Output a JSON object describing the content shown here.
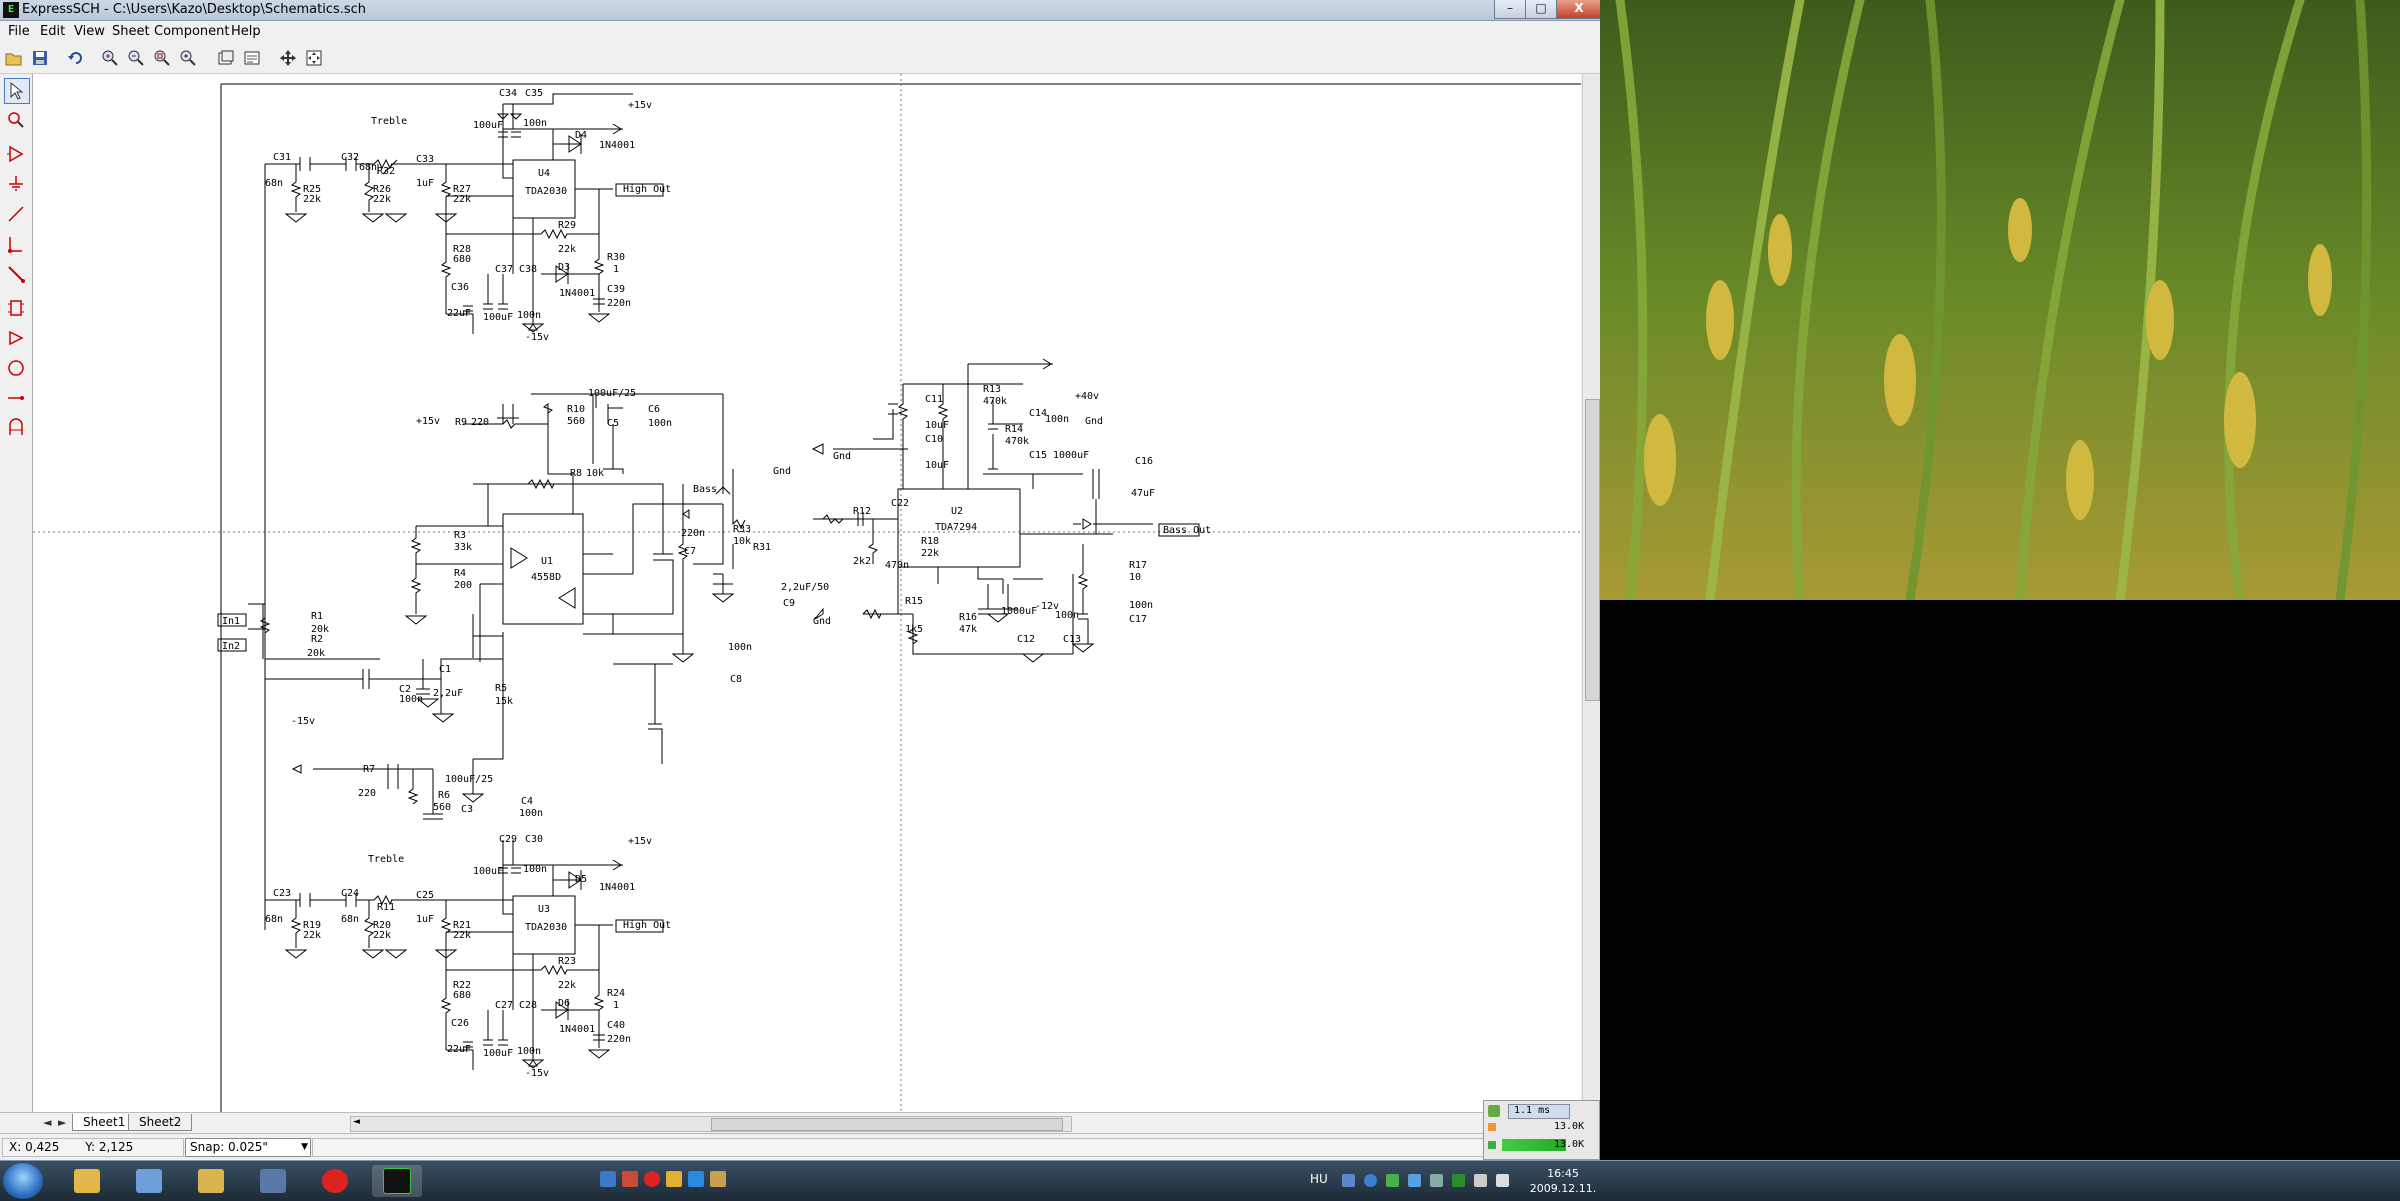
{
  "window": {
    "title": "ExpressSCH - C:\\Users\\Kazo\\Desktop\\Schematics.sch",
    "icon": "expresssch-icon",
    "minimize": "–",
    "maximize": "□",
    "close": "X"
  },
  "menu": [
    "File",
    "Edit",
    "View",
    "Sheet",
    "Component",
    "Help"
  ],
  "toolbar": [
    "open-icon",
    "save-icon",
    "undo-icon",
    "zoom-in-icon",
    "zoom-out-icon",
    "zoom-area-icon",
    "zoom-fit-icon",
    "sheet-icon",
    "sheet-props-icon",
    "move-icon",
    "pan-icon"
  ],
  "tools": [
    "select-pointer-icon",
    "zoom-select-icon",
    "component-icon",
    "ground-icon",
    "wire-icon",
    "junction-icon",
    "bus-icon",
    "part-icon",
    "port-icon",
    "circle-icon",
    "line-arrow-icon",
    "text-icon"
  ],
  "sheets": {
    "tabs": [
      "Sheet1",
      "Sheet2"
    ],
    "nav_left": "◄",
    "nav_right": "►",
    "hscroll_left": "◄",
    "hscroll_right": "►"
  },
  "status": {
    "x": "X: 0,425",
    "y": "Y: 2,125",
    "snap": "Snap: 0.025\""
  },
  "schematic": {
    "rails": {
      "plus15": "+15v",
      "minus15": "-15v",
      "plus40": "+40v",
      "minus12": "-12v",
      "gnd": "Gnd"
    },
    "ports": {
      "in1": "In1",
      "in2": "In2",
      "high_out": "High Out",
      "bass_out": "Bass Out"
    },
    "labels": {
      "treble": "Treble",
      "bass": "Bass"
    },
    "ics": {
      "u4_ref": "U4",
      "u4_part": "TDA2030",
      "u3_ref": "U3",
      "u3_part": "TDA2030",
      "u1_ref": "U1",
      "u1_part": "4558D",
      "u2_ref": "U2",
      "u2_part": "TDA7294"
    },
    "parts": {
      "c34": "C34",
      "c35": "C35",
      "c34v": "100uF",
      "c35v": "100n",
      "d4": "D4",
      "d4v": "1N4001",
      "c31": "C31",
      "c31v": "68n",
      "c32": "C32",
      "c32v": "68n",
      "c33": "C33",
      "c33v": "1uF",
      "r32": "R32",
      "r25": "R25",
      "r25v": "22k",
      "r26": "R26",
      "r26v": "22k",
      "r27": "R27",
      "r27v": "22k",
      "r28": "R28",
      "r28v": "680",
      "r29": "R29",
      "r29v": "22k",
      "d3": "D3",
      "d3v": "1N4001",
      "c36": "C36",
      "c36v": "22uF",
      "c37": "C37",
      "c37v": "100uF",
      "c38": "C38",
      "c38v": "100n",
      "r30": "R30",
      "r30v": "1",
      "c39": "C39",
      "c39v": "220n",
      "c29": "C29",
      "c30": "C30",
      "c29v": "100uF",
      "c30v": "100n",
      "d5": "D5",
      "d5v": "1N4001",
      "c23": "C23",
      "c23v": "68n",
      "c24": "C24",
      "c24v": "68n",
      "c25": "C25",
      "c25v": "1uF",
      "r11": "R11",
      "r19": "R19",
      "r19v": "22k",
      "r20": "R20",
      "r20v": "22k",
      "r21": "R21",
      "r21v": "22k",
      "r22": "R22",
      "r22v": "680",
      "r23": "R23",
      "r23v": "22k",
      "d6": "D6",
      "d6v": "1N4001",
      "c26": "C26",
      "c26v": "22uF",
      "c27": "C27",
      "c27v": "100uF",
      "c28": "C28",
      "c28v": "100n",
      "r24": "R24",
      "r24v": "1",
      "c40": "C40",
      "c40v": "220n",
      "r9": "R9",
      "r9v": "220",
      "r10": "R10",
      "r10v": "560",
      "c5": "C5",
      "c5v": "100uF/25",
      "c6": "C6",
      "c6v": "100n",
      "r8": "R8",
      "r8v": "10k",
      "r3": "R3",
      "r3v": "33k",
      "r4": "R4",
      "r4v": "200",
      "c7": "C7",
      "c7v": "220n",
      "r33": "R33",
      "r33v": "10k",
      "c8": "C8",
      "c8v": "100n",
      "r1": "R1",
      "r1v": "20k",
      "r2": "R2",
      "r2v": "20k",
      "c1": "C1",
      "c1v": "2,2uF",
      "c2": "C2",
      "c2v": "100n",
      "r5": "R5",
      "r5v": "15k",
      "r7": "R7",
      "r7v": "220",
      "r6": "R6",
      "r6v": "560",
      "c3": "C3",
      "c3v": "100uF/25",
      "c4": "C4",
      "c4v": "100n",
      "r31": "R31",
      "c9": "C9",
      "c9v": "2,2uF/50",
      "r12": "R12",
      "r12v": "2k2",
      "c22": "C22",
      "c22v": "470n",
      "r18": "R18",
      "r18v": "22k",
      "c11": "C11",
      "c11v": "10uF",
      "c10": "C10",
      "c10v": "10uF",
      "r13": "R13",
      "r13v": "470k",
      "r14": "R14",
      "r14v": "470k",
      "c14": "C14",
      "c14v": "100n",
      "c15": "C15",
      "c15v": "1000uF",
      "c16": "C16",
      "c16v": "47uF",
      "r15": "R15",
      "r15v": "1k5",
      "r16": "R16",
      "r16v": "47k",
      "c12": "C12",
      "c12v": "1000uF",
      "c13": "C13",
      "c13v": "100n",
      "r17": "R17",
      "r17v": "10",
      "c17": "C17",
      "c17v": "100n"
    }
  },
  "gadget": {
    "row1": "1.1 ms",
    "row2": "13.0K",
    "row3": "13.0K"
  },
  "taskbar": {
    "apps": [
      "explorer-folder-icon",
      "network-icon",
      "notepad-icon",
      "disk-icon",
      "opera-icon",
      "expresssch-task-icon"
    ],
    "quicklaunch": [
      "media-icon",
      "store-icon",
      "opera-ql-icon",
      "chrome-ql-icon",
      "ie-ql-icon",
      "pen-ql-icon"
    ],
    "lang": "HU",
    "time": "16:45",
    "date": "2009.12.11."
  },
  "colors": {
    "titlebar": "#b7c7d9",
    "wire": "#000000",
    "taskbar": "#1d2a36"
  }
}
